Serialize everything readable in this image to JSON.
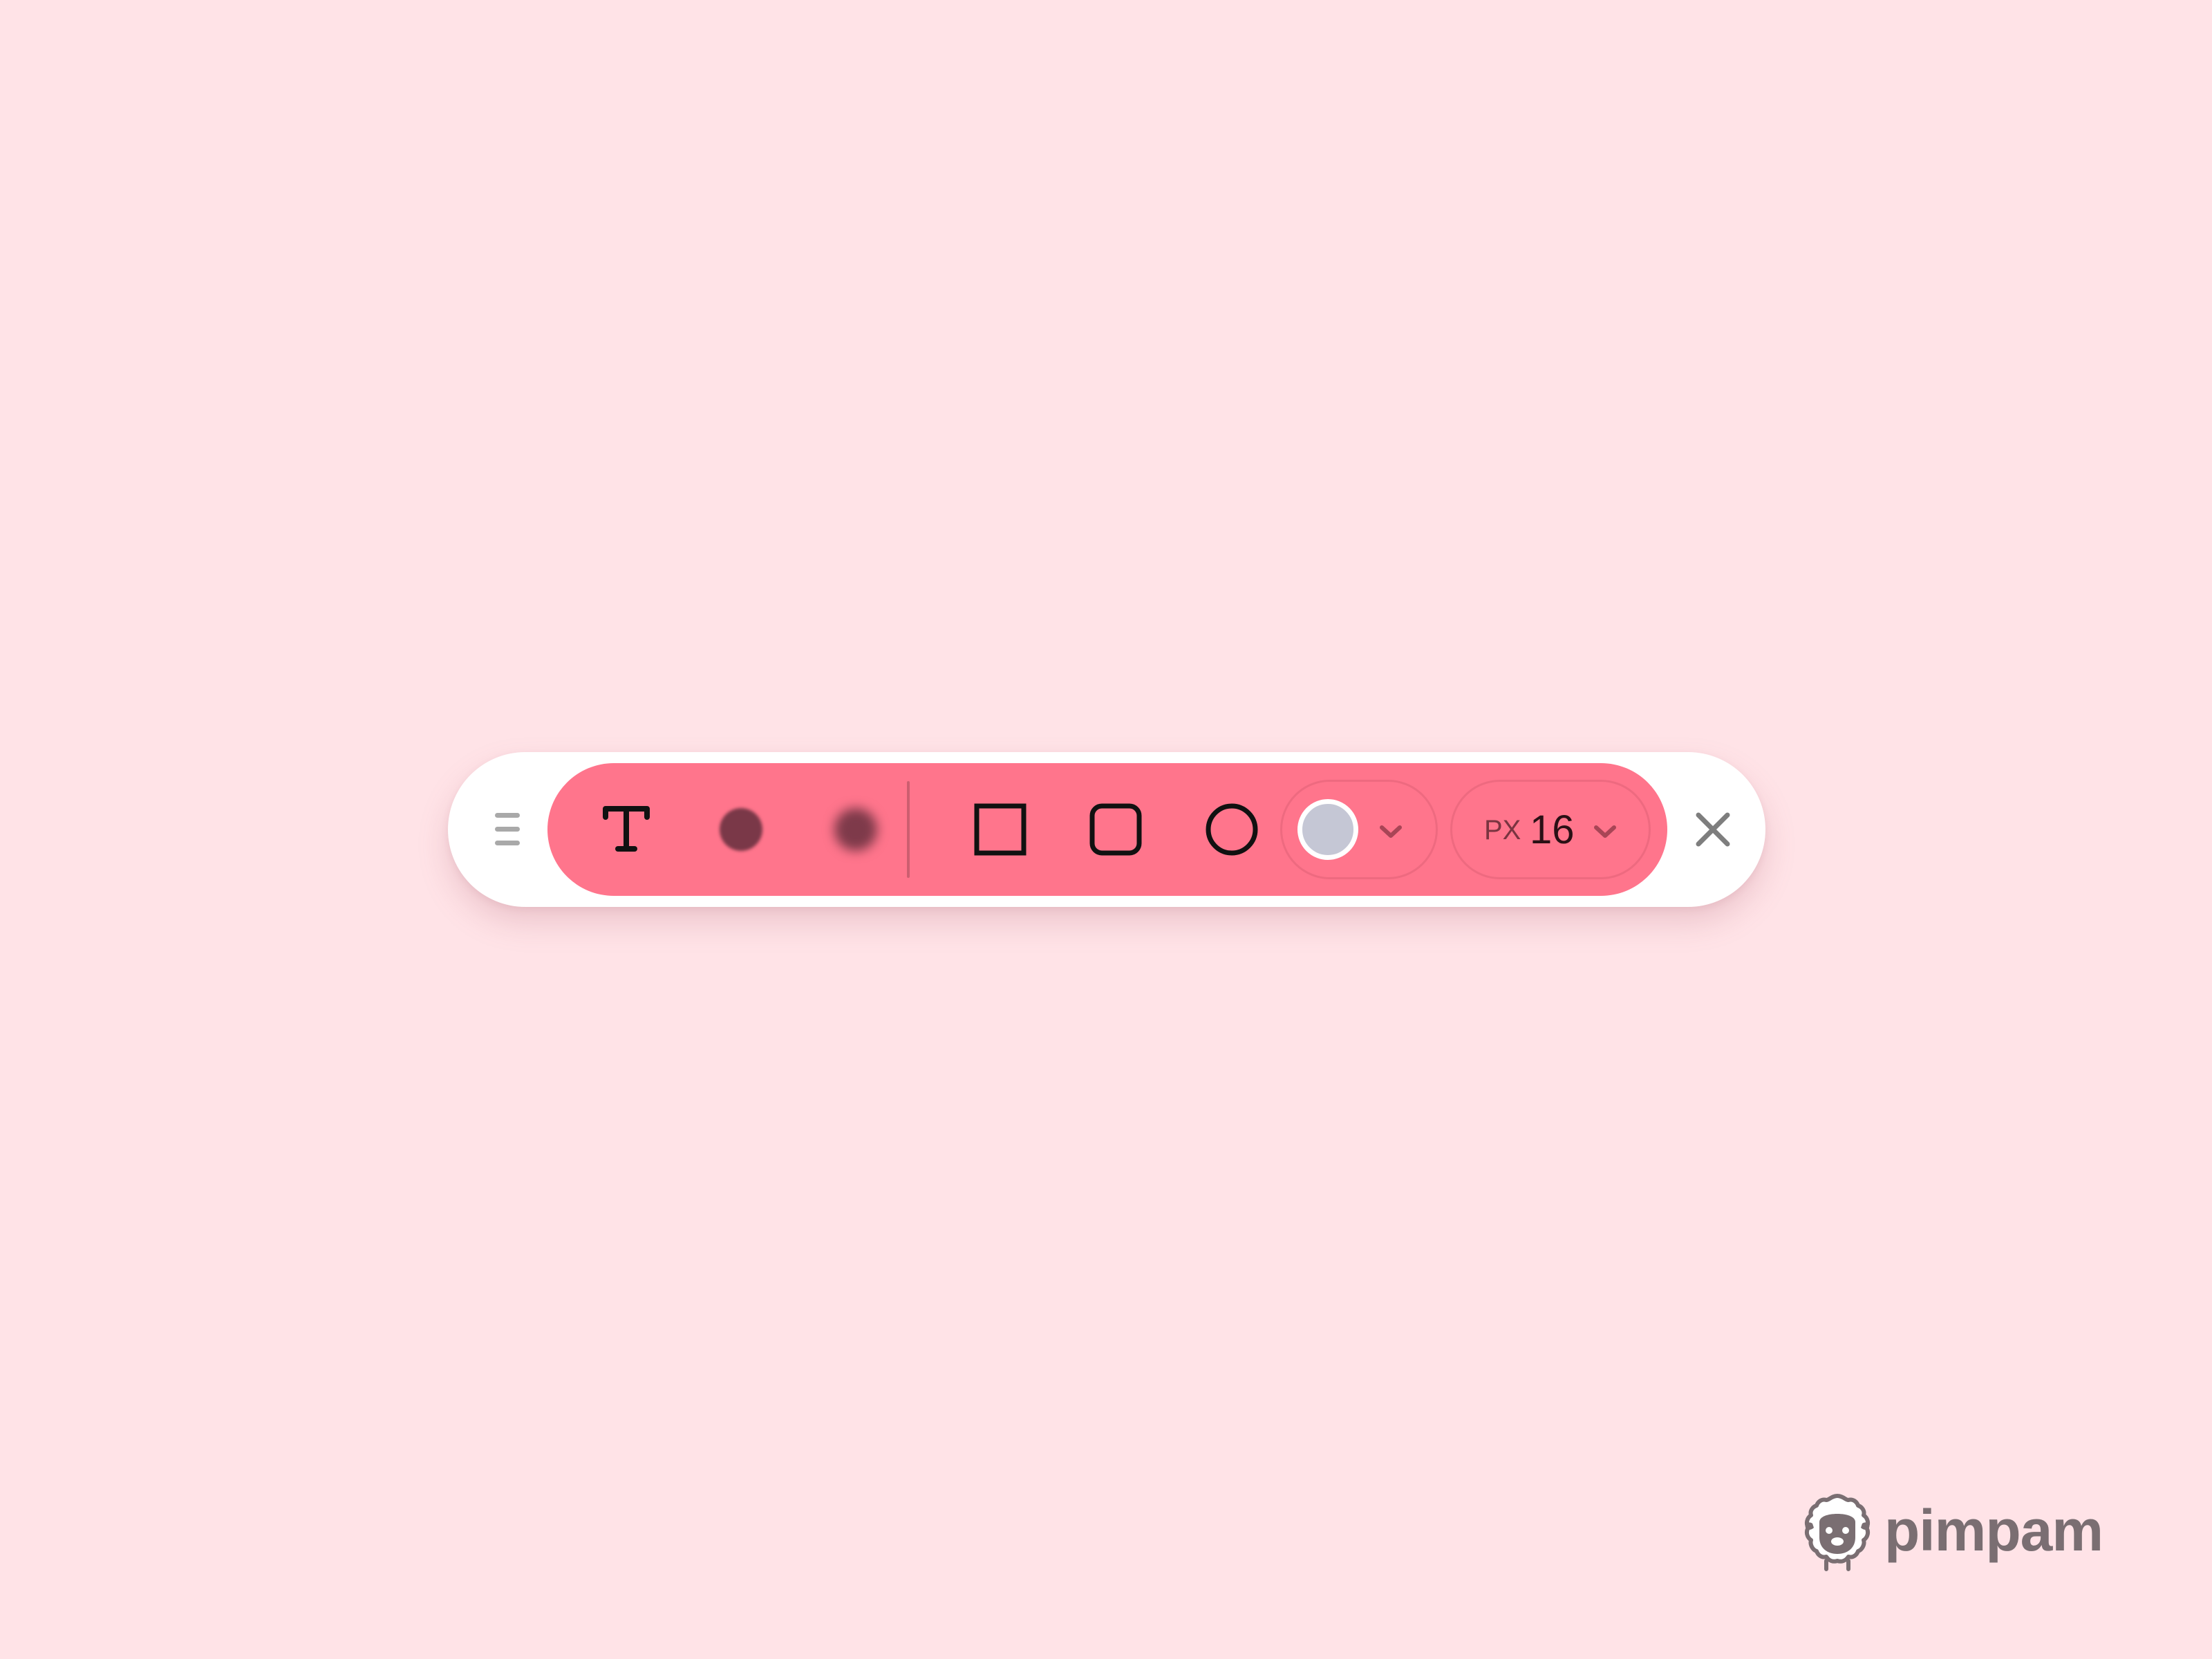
{
  "toolbar": {
    "tools": [
      {
        "id": "text",
        "icon": "text-t-icon"
      },
      {
        "id": "blur-soft",
        "icon": "blur-dot-icon"
      },
      {
        "id": "blur-strong",
        "icon": "blur-dot-heavy-icon"
      },
      {
        "id": "rectangle",
        "icon": "square-icon"
      },
      {
        "id": "rounded-rectangle",
        "icon": "rounded-square-icon"
      },
      {
        "id": "ellipse",
        "icon": "circle-icon"
      }
    ],
    "color_picker": {
      "selected_color": "#C5C7D5",
      "icon": "chevron-down-icon"
    },
    "size_picker": {
      "unit": "PX",
      "value": "16",
      "icon": "chevron-down-icon"
    },
    "close_icon": "close-icon",
    "drag_icon": "drag-handle-icon"
  },
  "colors": {
    "background": "#FFE3E7",
    "toolbar_bg": "#FFFFFF",
    "tools_pill": "#FF758C",
    "icon_dark": "#111111",
    "chevron": "#A84556",
    "close": "#7E7E7E",
    "brand": "#7A6E72"
  },
  "brand": {
    "name": "pimpam",
    "logo_icon": "sheep-logo-icon"
  }
}
